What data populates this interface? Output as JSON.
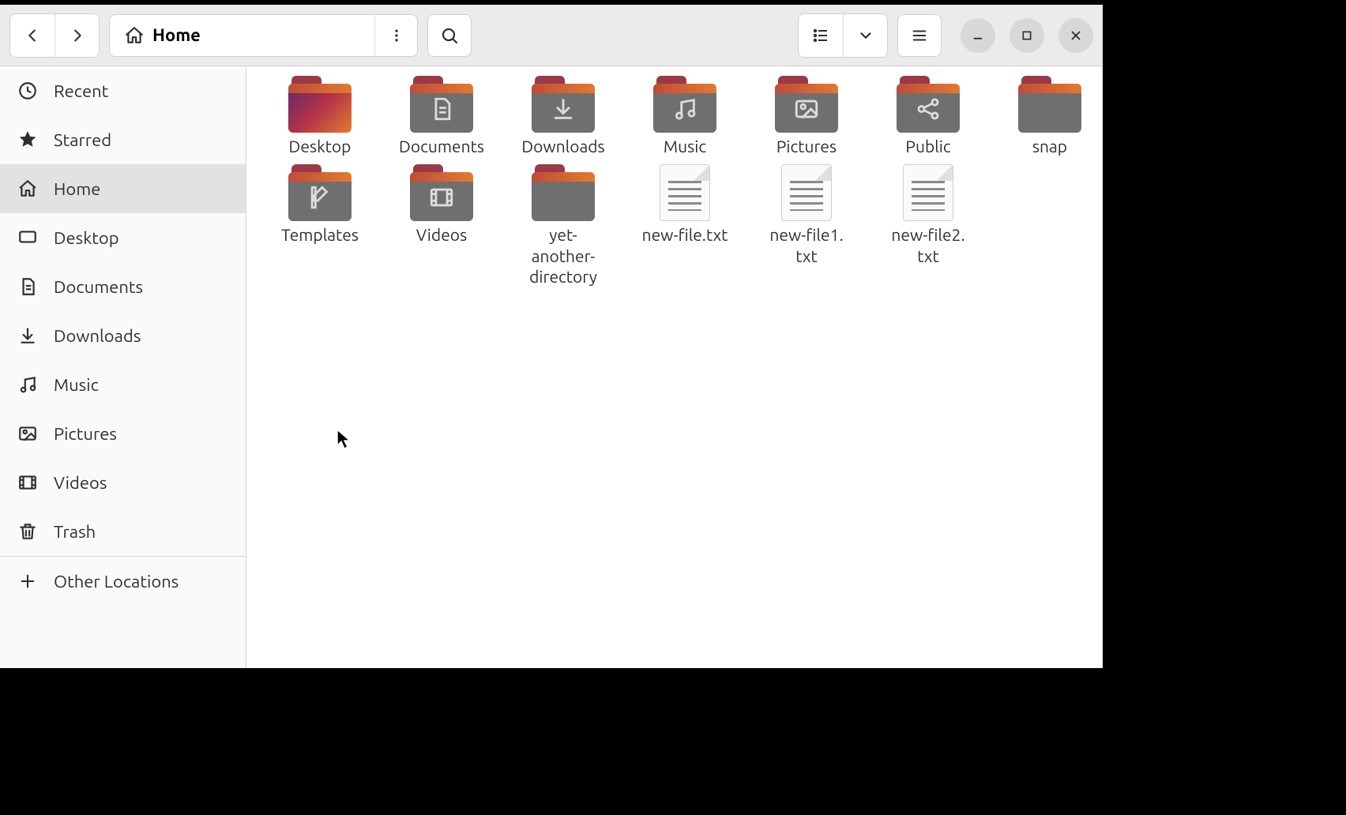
{
  "location": {
    "label": "Home"
  },
  "sidebar": {
    "items": [
      {
        "label": "Recent",
        "icon": "clock",
        "selected": false
      },
      {
        "label": "Starred",
        "icon": "star",
        "selected": false
      },
      {
        "label": "Home",
        "icon": "home",
        "selected": true
      },
      {
        "label": "Desktop",
        "icon": "desktop",
        "selected": false
      },
      {
        "label": "Documents",
        "icon": "documents",
        "selected": false
      },
      {
        "label": "Downloads",
        "icon": "downloads",
        "selected": false
      },
      {
        "label": "Music",
        "icon": "music",
        "selected": false
      },
      {
        "label": "Pictures",
        "icon": "pictures",
        "selected": false
      },
      {
        "label": "Videos",
        "icon": "videos",
        "selected": false
      },
      {
        "label": "Trash",
        "icon": "trash",
        "selected": false
      }
    ],
    "other": {
      "label": "Other Locations",
      "icon": "plus"
    }
  },
  "files": [
    {
      "name": "Desktop",
      "kind": "folder",
      "glyph": "desktop"
    },
    {
      "name": "Documents",
      "kind": "folder",
      "glyph": "documents"
    },
    {
      "name": "Downloads",
      "kind": "folder",
      "glyph": "downloads"
    },
    {
      "name": "Music",
      "kind": "folder",
      "glyph": "music"
    },
    {
      "name": "Pictures",
      "kind": "folder",
      "glyph": "pictures"
    },
    {
      "name": "Public",
      "kind": "folder",
      "glyph": "public"
    },
    {
      "name": "snap",
      "kind": "folder",
      "glyph": "none"
    },
    {
      "name": "Templates",
      "kind": "folder",
      "glyph": "templates"
    },
    {
      "name": "Videos",
      "kind": "folder",
      "glyph": "videos"
    },
    {
      "name": "yet-another-directory",
      "kind": "folder",
      "glyph": "none"
    },
    {
      "name": "new-file.txt",
      "kind": "textfile"
    },
    {
      "name": "new-file1.txt",
      "kind": "textfile"
    },
    {
      "name": "new-file2.txt",
      "kind": "textfile"
    }
  ]
}
